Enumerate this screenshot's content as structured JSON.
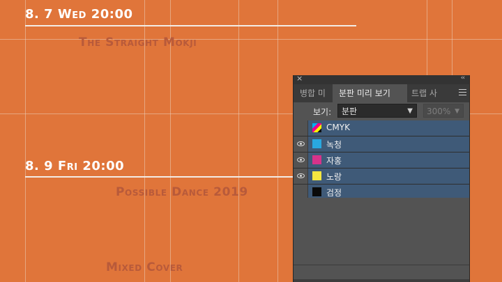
{
  "poster": {
    "event1_date": "8. 7 Wed 20:00",
    "event1_title": "The Straight Mokji",
    "event2_date": "8. 9 Fri 20:00",
    "event2_title": "Possible Dance 2019",
    "event3_title": "Mixed Cover",
    "background_color": "#e0753a"
  },
  "panel": {
    "close_icon": "×",
    "collapse_icon": "‹‹",
    "tabs": [
      {
        "label": "병합 미",
        "active": false
      },
      {
        "label": "분판 미리 보기",
        "active": true
      },
      {
        "label": "트랩 사",
        "active": false
      }
    ],
    "view_label": "보기:",
    "view_value": "분판",
    "zoom_value": "300%",
    "separations": [
      {
        "name": "CMYK",
        "visible": false,
        "color": "cmyk"
      },
      {
        "name": "녹청",
        "visible": true,
        "color": "#29a8e0"
      },
      {
        "name": "자홍",
        "visible": true,
        "color": "#d6338a"
      },
      {
        "name": "노랑",
        "visible": true,
        "color": "#f5e640"
      },
      {
        "name": "검정",
        "visible": false,
        "color": "#0a0a0a"
      }
    ]
  }
}
